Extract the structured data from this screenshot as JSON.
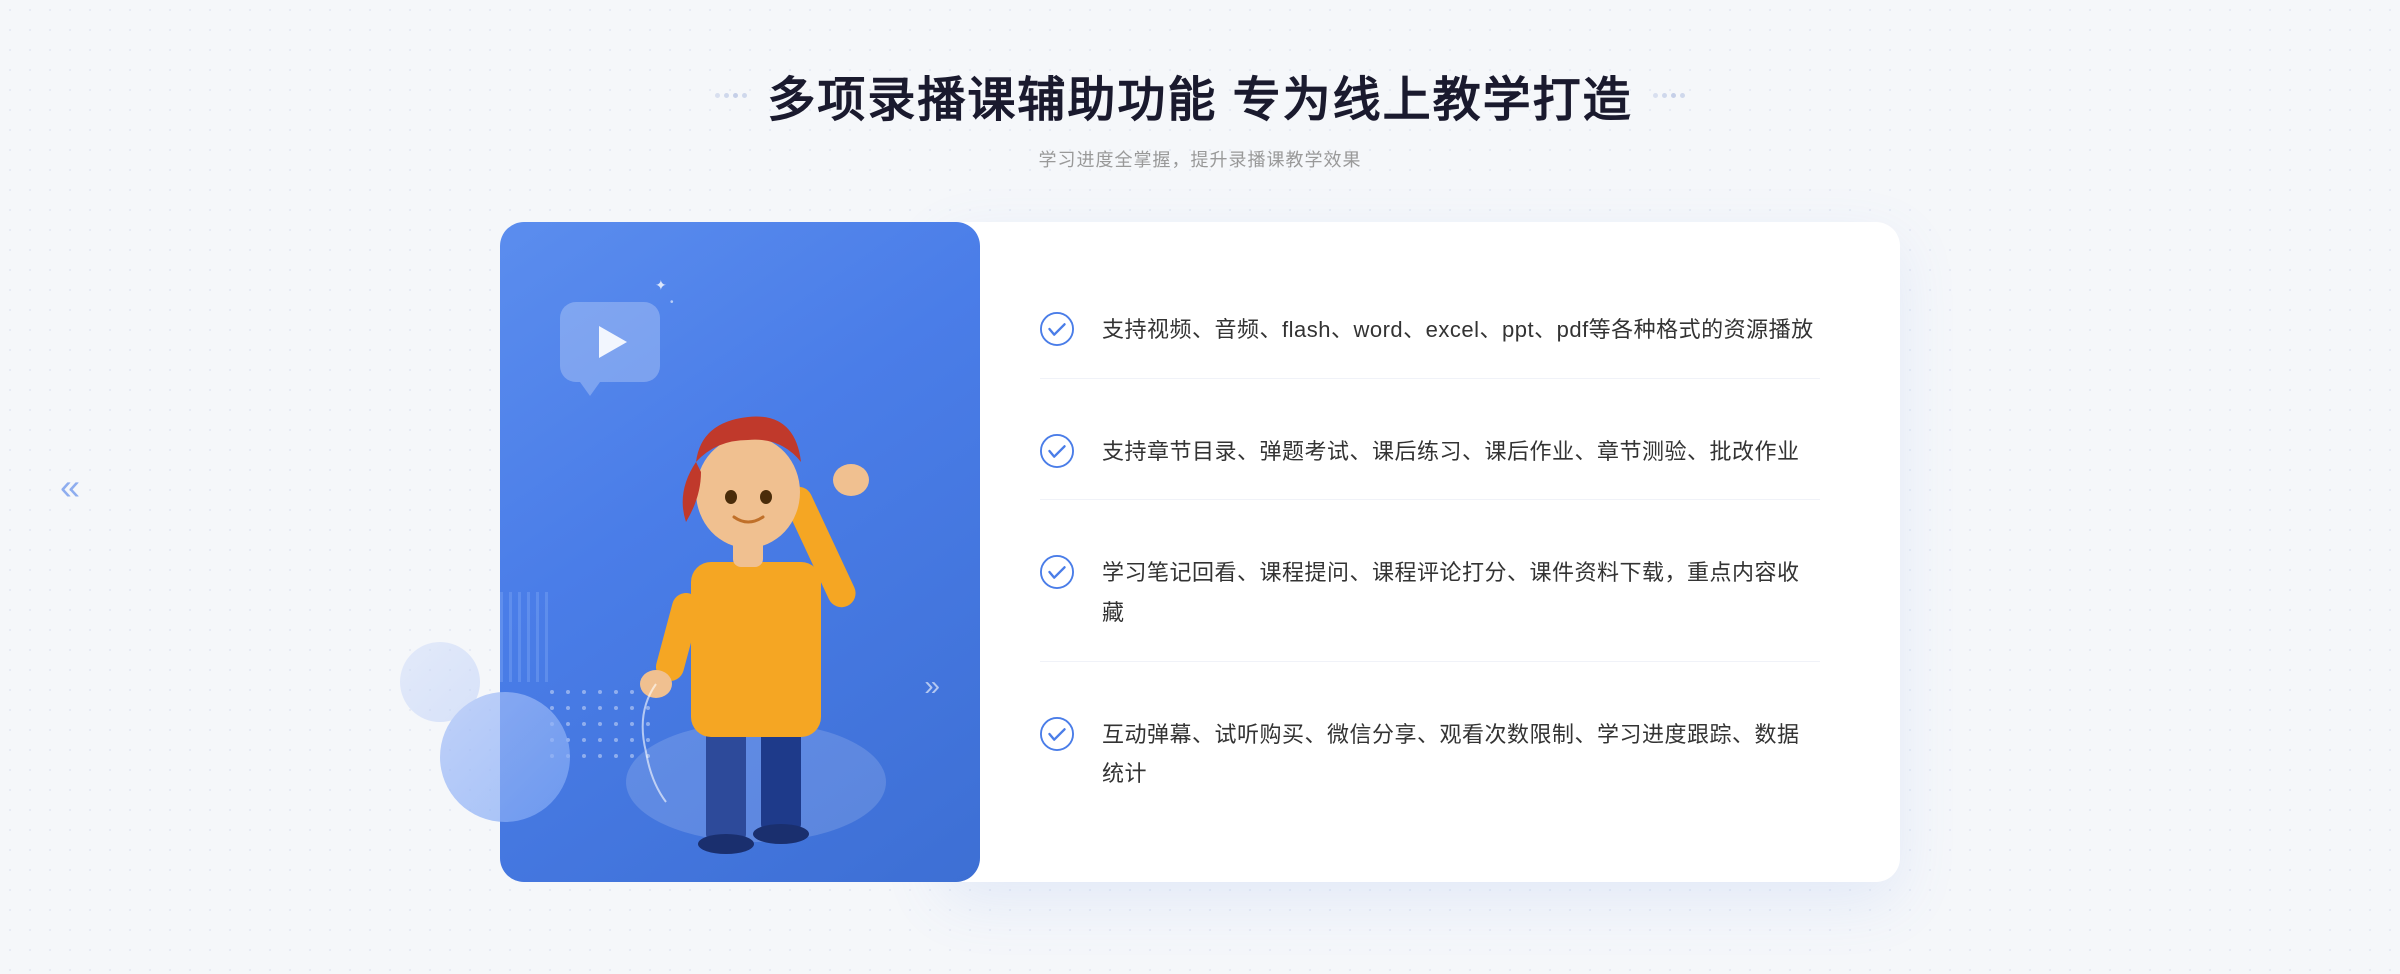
{
  "header": {
    "title": "多项录播课辅助功能 专为线上教学打造",
    "subtitle": "学习进度全掌握，提升录播课教学效果",
    "deco_dots_left": [
      "·",
      "·",
      "·",
      "·"
    ],
    "deco_dots_right": [
      "·",
      "·",
      "·",
      "·"
    ]
  },
  "features": [
    {
      "id": "feature-1",
      "text": "支持视频、音频、flash、word、excel、ppt、pdf等各种格式的资源播放"
    },
    {
      "id": "feature-2",
      "text": "支持章节目录、弹题考试、课后练习、课后作业、章节测验、批改作业"
    },
    {
      "id": "feature-3",
      "text": "学习笔记回看、课程提问、课程评论打分、课件资料下载，重点内容收藏"
    },
    {
      "id": "feature-4",
      "text": "互动弹幕、试听购买、微信分享、观看次数限制、学习进度跟踪、数据统计"
    }
  ],
  "colors": {
    "primary_blue": "#4a7de8",
    "light_blue": "#7fa8f5",
    "bg": "#f5f7fa",
    "text_dark": "#1a1a2e",
    "text_gray": "#999",
    "text_feature": "#333"
  }
}
